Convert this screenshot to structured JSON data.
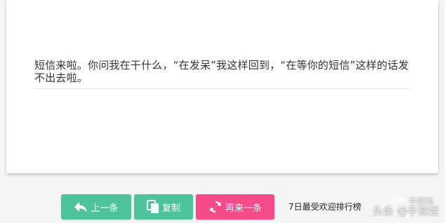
{
  "quote": {
    "text": "短信来啦。你问我在干什么，“在发呆”我这样回到，“在等你的短信”这样的话发不出去啦。"
  },
  "buttons": {
    "prev_label": "上一条",
    "copy_label": "复制",
    "next_label": "再来一条"
  },
  "ranking_link": "7日最受欢迎排行榜",
  "watermark": {
    "line1": "手赚姬",
    "line2": "头条 @手赚姬"
  },
  "colors": {
    "green": "#4fc49a",
    "pink": "#f54b8a"
  },
  "icons": {
    "prev": "back-arrow-icon",
    "copy": "copy-icon",
    "next": "refresh-icon"
  }
}
